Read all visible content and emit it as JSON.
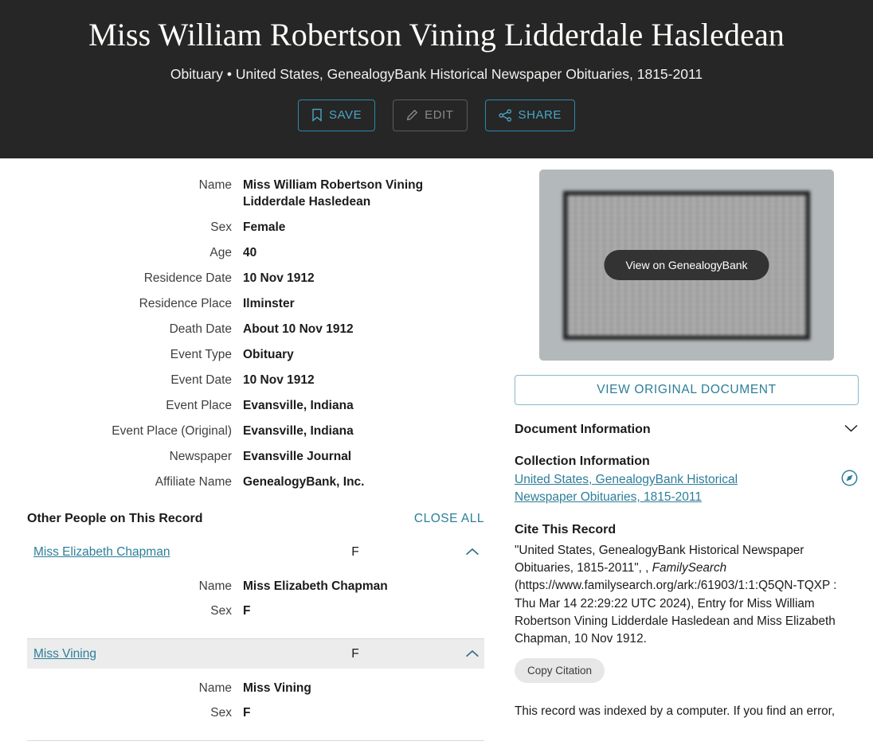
{
  "header": {
    "title": "Miss William Robertson Vining Lidderdale Hasledean",
    "subtitle": "Obituary • United States, GenealogyBank Historical Newspaper Obituaries, 1815-2011",
    "actions": {
      "save_label": "SAVE",
      "edit_label": "EDIT",
      "share_label": "SHARE"
    }
  },
  "details": [
    {
      "label": "Name",
      "value": "Miss William Robertson Vining Lidderdale Hasledean"
    },
    {
      "label": "Sex",
      "value": "Female"
    },
    {
      "label": "Age",
      "value": "40"
    },
    {
      "label": "Residence Date",
      "value": "10 Nov 1912"
    },
    {
      "label": "Residence Place",
      "value": "Ilminster"
    },
    {
      "label": "Death Date",
      "value": "About 10 Nov 1912"
    },
    {
      "label": "Event Type",
      "value": "Obituary"
    },
    {
      "label": "Event Date",
      "value": "10 Nov 1912"
    },
    {
      "label": "Event Place",
      "value": "Evansville, Indiana"
    },
    {
      "label": "Event Place (Original)",
      "value": "Evansville, Indiana"
    },
    {
      "label": "Newspaper",
      "value": "Evansville Journal"
    },
    {
      "label": "Affiliate Name",
      "value": "GenealogyBank, Inc."
    }
  ],
  "other_people": {
    "title": "Other People on This Record",
    "close_all_label": "CLOSE ALL",
    "people": [
      {
        "name": "Miss Elizabeth Chapman",
        "sex": "F",
        "expanded": true,
        "highlight": false,
        "fields": [
          {
            "label": "Name",
            "value": "Miss Elizabeth Chapman"
          },
          {
            "label": "Sex",
            "value": "F"
          }
        ]
      },
      {
        "name": "Miss Vining",
        "sex": "F",
        "expanded": true,
        "highlight": true,
        "fields": [
          {
            "label": "Name",
            "value": "Miss Vining"
          },
          {
            "label": "Sex",
            "value": "F"
          }
        ]
      }
    ]
  },
  "right": {
    "thumbnail_button_label": "View on GenealogyBank",
    "view_original_label": "VIEW ORIGINAL DOCUMENT",
    "document_information_label": "Document Information",
    "collection_information_label": "Collection Information",
    "collection_link": "United States, GenealogyBank Historical Newspaper Obituaries, 1815-2011",
    "cite_this_record_label": "Cite This Record",
    "citation_part1": " \"United States, GenealogyBank Historical Newspaper Obituaries, 1815-2011\", , ",
    "citation_italic": "FamilySearch",
    "citation_part2": " (https://www.familysearch.org/ark:/61903/1:1:Q5QN-TQXP : Thu Mar 14 22:29:22 UTC 2024), Entry for Miss William Robertson Vining Lidderdale Hasledean and Miss Elizabeth Chapman, 10 Nov 1912.",
    "copy_citation_label": "Copy Citation",
    "indexed_note": "This record was indexed by a computer. If you find an error,"
  },
  "colors": {
    "header_bg": "#262626",
    "accent_link": "#2d7e9a",
    "accent_button": "#49a6c4",
    "highlight_row": "#ececec"
  }
}
